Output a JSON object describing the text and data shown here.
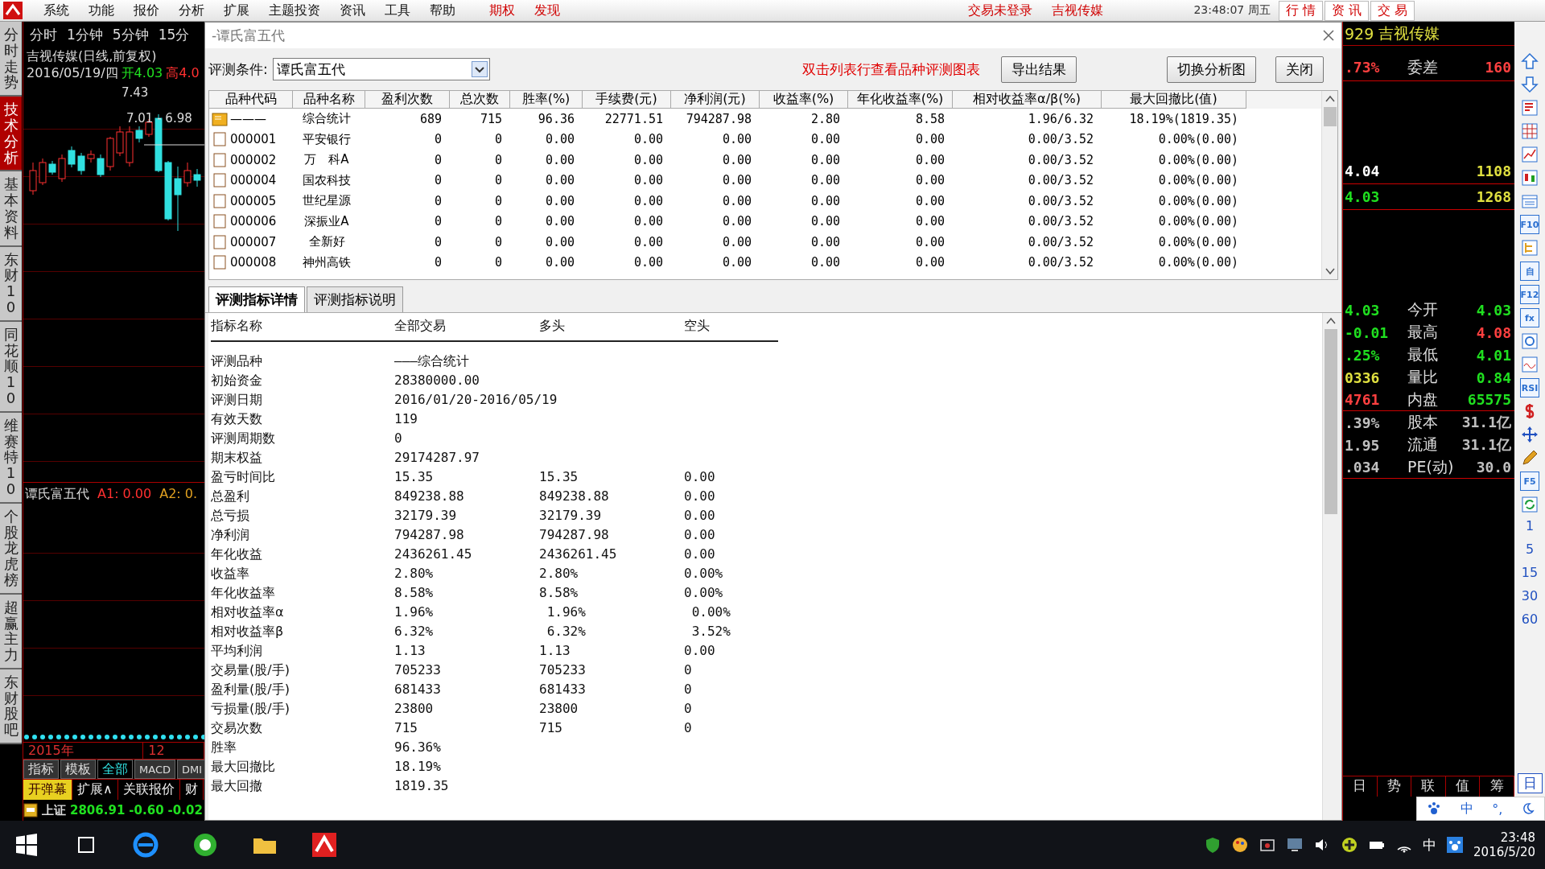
{
  "menu_bar": {
    "items": [
      "系统",
      "功能",
      "报价",
      "分析",
      "扩展",
      "主题投资",
      "资讯",
      "工具",
      "帮助"
    ],
    "links": [
      "期权",
      "发现"
    ],
    "status": [
      "交易未登录",
      "吉视传媒"
    ],
    "clock": "23:48:07 周五",
    "right_tabs": [
      "行 情",
      "资 讯",
      "交 易"
    ]
  },
  "left_panel": {
    "vertical_tabs": [
      {
        "label": "分时走势",
        "selected": false
      },
      {
        "label": "技术分析",
        "selected": true
      },
      {
        "label": "基本资料",
        "selected": false
      },
      {
        "label": "东财10",
        "selected": false
      },
      {
        "label": "同花顺10",
        "selected": false
      },
      {
        "label": "维赛特10",
        "selected": false
      },
      {
        "label": "个股龙虎榜",
        "selected": false
      },
      {
        "label": "超赢主力",
        "selected": false
      },
      {
        "label": "东财股吧",
        "selected": false
      }
    ],
    "period_tabs": [
      "分时",
      "1分钟",
      "5分钟",
      "15分"
    ],
    "stock_title": "吉视传媒(日线,前复权)",
    "date": "2016/05/19/四",
    "open": "开4.03",
    "high": "高4.0",
    "price_labels": [
      "7.43",
      "7.01 - 6.98"
    ],
    "indicator": {
      "name": "谭氏富五代",
      "a1": "A1: 0.00",
      "a2": "A2: 0."
    },
    "axis": [
      "2015年",
      "12"
    ],
    "tool_tabs": [
      {
        "label": "指标",
        "selected": false
      },
      {
        "label": "模板",
        "selected": false
      },
      {
        "label": "全部",
        "selected": true
      },
      {
        "label": "MACD",
        "selected": false
      },
      {
        "label": "DMI",
        "selected": false
      }
    ],
    "bottom_buttons": [
      {
        "label": "开弹幕",
        "selected": true
      },
      {
        "label": "扩展∧",
        "selected": false
      },
      {
        "label": "关联报价",
        "selected": false
      },
      {
        "label": "财",
        "selected": false
      }
    ],
    "index": {
      "name": "上证",
      "value": "2806.91",
      "change": "-0.60",
      "percent": "-0.02"
    }
  },
  "dialog": {
    "title": "-谭氏富五代",
    "condition_label": "评测条件:",
    "condition_value": "谭氏富五代",
    "hint": "双击列表行查看品种评测图表",
    "buttons": [
      "导出结果",
      "切换分析图",
      "关闭"
    ],
    "table": {
      "columns": [
        "品种代码",
        "品种名称",
        "盈利次数",
        "总次数",
        "胜率(%)",
        "手续费(元)",
        "净利润(元)",
        "收益率(%)",
        "年化收益率(%)",
        "相对收益率α/β(%)",
        "最大回撤比(值)"
      ],
      "rows": [
        {
          "kind": "summary",
          "cells": [
            "———",
            "综合统计",
            "689",
            "715",
            "96.36",
            "22771.51",
            "794287.98",
            "2.80",
            "8.58",
            "1.96/6.32",
            "18.19%(1819.35)"
          ]
        },
        {
          "kind": "stock",
          "cells": [
            "000001",
            "平安银行",
            "0",
            "0",
            "0.00",
            "0.00",
            "0.00",
            "0.00",
            "0.00",
            "0.00/3.52",
            "0.00%(0.00)"
          ]
        },
        {
          "kind": "stock",
          "cells": [
            "000002",
            "万　科A",
            "0",
            "0",
            "0.00",
            "0.00",
            "0.00",
            "0.00",
            "0.00",
            "0.00/3.52",
            "0.00%(0.00)"
          ]
        },
        {
          "kind": "stock",
          "cells": [
            "000004",
            "国农科技",
            "0",
            "0",
            "0.00",
            "0.00",
            "0.00",
            "0.00",
            "0.00",
            "0.00/3.52",
            "0.00%(0.00)"
          ]
        },
        {
          "kind": "stock",
          "cells": [
            "000005",
            "世纪星源",
            "0",
            "0",
            "0.00",
            "0.00",
            "0.00",
            "0.00",
            "0.00",
            "0.00/3.52",
            "0.00%(0.00)"
          ]
        },
        {
          "kind": "stock",
          "cells": [
            "000006",
            "深振业A",
            "0",
            "0",
            "0.00",
            "0.00",
            "0.00",
            "0.00",
            "0.00",
            "0.00/3.52",
            "0.00%(0.00)"
          ]
        },
        {
          "kind": "stock",
          "cells": [
            "000007",
            "全新好",
            "0",
            "0",
            "0.00",
            "0.00",
            "0.00",
            "0.00",
            "0.00",
            "0.00/3.52",
            "0.00%(0.00)"
          ]
        },
        {
          "kind": "stock",
          "cells": [
            "000008",
            "神州高铁",
            "0",
            "0",
            "0.00",
            "0.00",
            "0.00",
            "0.00",
            "0.00",
            "0.00/3.52",
            "0.00%(0.00)"
          ]
        }
      ]
    },
    "detail_tabs": [
      {
        "label": "评测指标详情",
        "selected": true
      },
      {
        "label": "评测指标说明",
        "selected": false
      }
    ],
    "detail": {
      "columns": [
        "指标名称",
        "全部交易",
        "多头",
        "空头"
      ],
      "rows": [
        {
          "name": "评测品种",
          "values": [
            "———综合统计"
          ]
        },
        {
          "name": "初始资金",
          "values": [
            "28380000.00"
          ]
        },
        {
          "name": "评测日期",
          "values": [
            "2016/01/20-2016/05/19"
          ]
        },
        {
          "name": "有效天数",
          "values": [
            "119"
          ]
        },
        {
          "name": "评测周期数",
          "values": [
            "0"
          ]
        },
        {
          "name": "期末权益",
          "values": [
            "29174287.97"
          ]
        },
        {
          "name": "盈亏时间比",
          "values": [
            "15.35",
            "15.35",
            "0.00"
          ]
        },
        {
          "name": "总盈利",
          "values": [
            "849238.88",
            "849238.88",
            "0.00"
          ]
        },
        {
          "name": "总亏损",
          "values": [
            "32179.39",
            "32179.39",
            "0.00"
          ]
        },
        {
          "name": "净利润",
          "values": [
            "794287.98",
            "794287.98",
            "0.00"
          ]
        },
        {
          "name": "年化收益",
          "values": [
            "2436261.45",
            "2436261.45",
            "0.00"
          ]
        },
        {
          "name": "收益率",
          "values": [
            "2.80%",
            "2.80%",
            "0.00%"
          ]
        },
        {
          "name": "年化收益率",
          "values": [
            "8.58%",
            "8.58%",
            "0.00%"
          ]
        },
        {
          "name": "相对收益率α",
          "values": [
            "1.96%",
            " 1.96%",
            " 0.00%"
          ]
        },
        {
          "name": "相对收益率β",
          "values": [
            "6.32%",
            " 6.32%",
            " 3.52%"
          ]
        },
        {
          "name": "平均利润",
          "values": [
            "1.13",
            "1.13",
            "0.00"
          ]
        },
        {
          "name": "交易量(股/手)",
          "values": [
            "705233",
            "705233",
            "0"
          ]
        },
        {
          "name": "盈利量(股/手)",
          "values": [
            "681433",
            "681433",
            "0"
          ]
        },
        {
          "name": "亏损量(股/手)",
          "values": [
            "23800",
            "23800",
            "0"
          ]
        },
        {
          "name": "交易次数",
          "values": [
            "715",
            "715",
            "0"
          ]
        },
        {
          "name": "胜率",
          "values": [
            "96.36%"
          ]
        },
        {
          "name": "最大回撤比",
          "values": [
            "18.19%"
          ]
        },
        {
          "name": "最大回撤",
          "values": [
            "1819.35"
          ]
        }
      ]
    }
  },
  "right_panel": {
    "header": {
      "code": "929",
      "name": "吉视传媒"
    },
    "spread": {
      "left": {
        "text": ".73%",
        "color": "#ff4040"
      },
      "label": "委差",
      "right": {
        "text": "160",
        "color": "#ff4040"
      }
    },
    "orders": [
      {
        "left": {
          "text": "4.04",
          "color": "#ffffff"
        },
        "right": {
          "text": "1108",
          "color": "#e0e040"
        }
      },
      {
        "left": {
          "text": "4.03",
          "color": "#20e020"
        },
        "right": {
          "text": "1268",
          "color": "#e0e040"
        }
      }
    ],
    "stats": [
      {
        "left": {
          "text": "4.03",
          "color": "#20e020"
        },
        "label": "今开",
        "right": {
          "text": "4.03",
          "color": "#20e020"
        }
      },
      {
        "left": {
          "text": "-0.01",
          "color": "#20e020"
        },
        "label": "最高",
        "right": {
          "text": "4.08",
          "color": "#ff4040"
        }
      },
      {
        "left": {
          "text": ".25%",
          "color": "#20e020"
        },
        "label": "最低",
        "right": {
          "text": "4.01",
          "color": "#20e020"
        }
      },
      {
        "left": {
          "text": "0336",
          "color": "#e0e040"
        },
        "label": "量比",
        "right": {
          "text": "0.84",
          "color": "#20e020"
        }
      },
      {
        "left": {
          "text": "4761",
          "color": "#ff4040"
        },
        "label": "内盘",
        "right": {
          "text": "65575",
          "color": "#20e020"
        }
      }
    ],
    "capital": [
      {
        "left": {
          "text": ".39%",
          "color": "#c0c0c0"
        },
        "label": "股本",
        "right": {
          "text": "31.1亿",
          "color": "#c0c0c0"
        }
      },
      {
        "left": {
          "text": "1.95",
          "color": "#c0c0c0"
        },
        "label": "流通",
        "right": {
          "text": "31.1亿",
          "color": "#c0c0c0"
        }
      },
      {
        "left": {
          "text": ".034",
          "color": "#c0c0c0"
        },
        "label": "PE(动)",
        "right": {
          "text": "30.0",
          "color": "#c0c0c0"
        }
      }
    ],
    "bottom_tabs": [
      "日",
      "势",
      "联",
      "值",
      "筹"
    ]
  },
  "right_toolbar": {
    "tools": [
      {
        "kind": "up"
      },
      {
        "kind": "down"
      },
      {
        "kind": "report"
      },
      {
        "kind": "grid"
      },
      {
        "kind": "line"
      },
      {
        "kind": "candle"
      },
      {
        "kind": "window"
      },
      {
        "kind": "label",
        "text": "F10"
      },
      {
        "kind": "tree"
      },
      {
        "kind": "label",
        "text": "自"
      },
      {
        "kind": "label",
        "text": "F12"
      },
      {
        "kind": "label",
        "text": "fx"
      },
      {
        "kind": "circle"
      },
      {
        "kind": "wave"
      },
      {
        "kind": "label",
        "text": "RSI"
      },
      {
        "kind": "dollar"
      },
      {
        "kind": "move"
      },
      {
        "kind": "pencil"
      },
      {
        "kind": "label",
        "text": "F5"
      },
      {
        "kind": "refresh"
      }
    ],
    "periods": [
      "1",
      "5",
      "15",
      "30",
      "60"
    ],
    "day": "日"
  },
  "ime_bar": {
    "mode": "中",
    "punctuation": "°,"
  },
  "taskbar": {
    "ime": "中",
    "time": "23:48",
    "date": "2016/5/20"
  }
}
